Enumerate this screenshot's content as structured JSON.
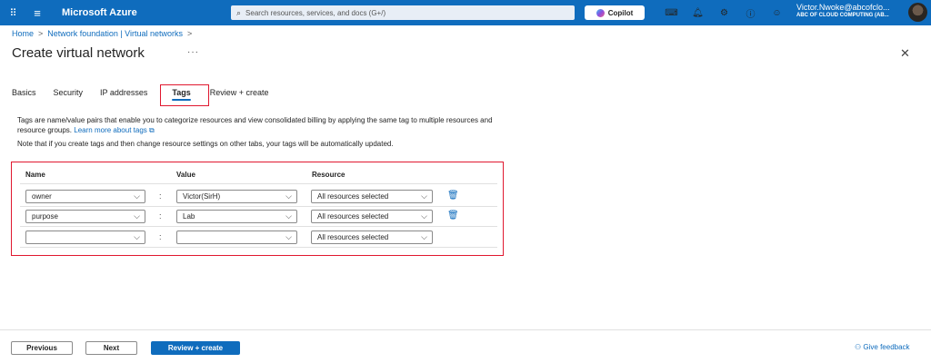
{
  "topbar": {
    "brand": "Microsoft Azure",
    "search_placeholder": "Search resources, services, and docs (G+/)",
    "copilot_label": "Copilot",
    "account_name": "Victor.Nwoke@abcofclo...",
    "account_org": "ABC OF CLOUD COMPUTING (AB..."
  },
  "breadcrumb": {
    "home": "Home",
    "parent": "Network foundation | Virtual networks"
  },
  "page": {
    "title": "Create virtual network",
    "more": "···"
  },
  "tabs": [
    {
      "label": "Basics"
    },
    {
      "label": "Security"
    },
    {
      "label": "IP addresses"
    },
    {
      "label": "Tags"
    },
    {
      "label": "Review + create"
    }
  ],
  "content": {
    "description": "Tags are name/value pairs that enable you to categorize resources and view consolidated billing by applying the same tag to multiple resources and resource groups.",
    "learn_more": "Learn more about tags",
    "note": "Note that if you create tags and then change resource settings on other tabs, your tags will be automatically updated."
  },
  "grid": {
    "headers": {
      "name": "Name",
      "value": "Value",
      "resource": "Resource"
    },
    "rows": [
      {
        "name": "owner",
        "value": "Victor(SirH)",
        "resource": "All resources selected"
      },
      {
        "name": "purpose",
        "value": "Lab",
        "resource": "All resources selected"
      },
      {
        "name": "",
        "value": "",
        "resource": "All resources selected"
      }
    ]
  },
  "footer": {
    "previous": "Previous",
    "next": "Next",
    "review_create": "Review + create",
    "feedback": "Give feedback"
  },
  "colors": {
    "accent": "#0f6cbd",
    "highlight": "#e0182f"
  }
}
